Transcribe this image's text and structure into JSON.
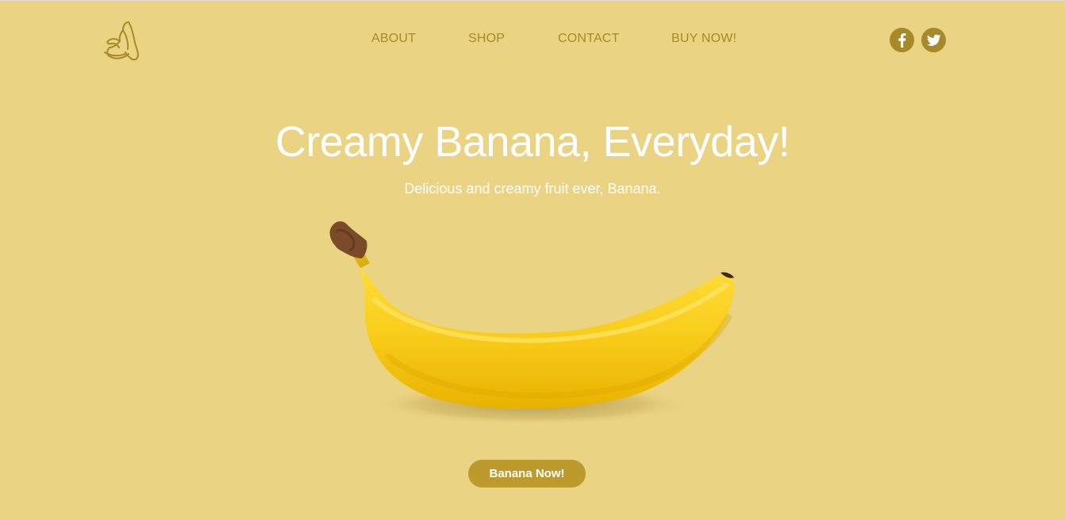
{
  "brand": {
    "logo_icon": "banana-icon"
  },
  "nav": {
    "items": [
      {
        "label": "ABOUT"
      },
      {
        "label": "SHOP"
      },
      {
        "label": "CONTACT"
      },
      {
        "label": "BUY NOW!"
      }
    ]
  },
  "social": [
    {
      "icon": "facebook-icon"
    },
    {
      "icon": "twitter-icon"
    }
  ],
  "hero": {
    "title": "Creamy Banana, Everyday!",
    "subtitle": "Delicious and creamy fruit ever, Banana.",
    "cta_label": "Banana Now!"
  },
  "colors": {
    "background": "#ead382",
    "nav_text": "#a8892a",
    "accent": "#bd9a2e",
    "hero_text": "#ffffff"
  }
}
